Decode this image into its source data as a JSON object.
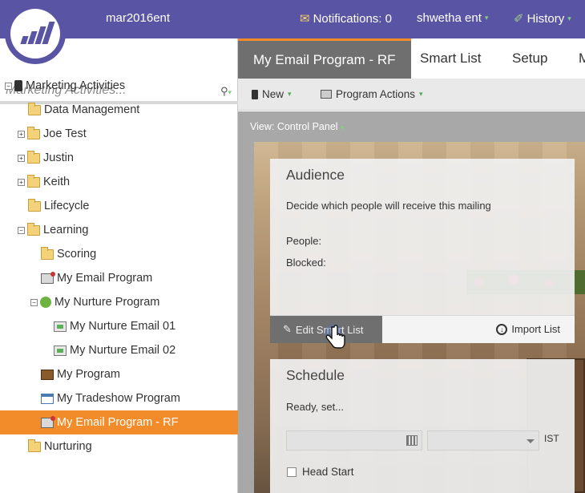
{
  "topbar": {
    "workspace": "mar2016ent",
    "notifications": "Notifications: 0",
    "user": "shwetha ent",
    "history": "History"
  },
  "leftpanel": {
    "search_placeholder": "Marketing Activities...",
    "tree": [
      {
        "label": "Marketing Activities",
        "icon": "marketing-activities-icon",
        "indent": 0,
        "expander": "−"
      },
      {
        "label": "Data Management",
        "icon": "folder-icon",
        "indent": 1,
        "expander": ""
      },
      {
        "label": "Joe Test",
        "icon": "folder-icon",
        "indent": 1,
        "expander": "+"
      },
      {
        "label": "Justin",
        "icon": "folder-icon",
        "indent": 1,
        "expander": "+"
      },
      {
        "label": "Keith",
        "icon": "folder-icon",
        "indent": 1,
        "expander": "+"
      },
      {
        "label": "Lifecycle",
        "icon": "folder-icon",
        "indent": 1,
        "expander": ""
      },
      {
        "label": "Learning",
        "icon": "folder-icon",
        "indent": 1,
        "expander": "−"
      },
      {
        "label": "Scoring",
        "icon": "folder-icon",
        "indent": 2,
        "expander": ""
      },
      {
        "label": "My Email Program",
        "icon": "email-program-icon",
        "indent": 2,
        "expander": ""
      },
      {
        "label": "My Nurture Program",
        "icon": "nurture-program-icon",
        "indent": 2,
        "expander": "−"
      },
      {
        "label": "My Nurture Email 01",
        "icon": "email-asset-icon",
        "indent": 3,
        "expander": ""
      },
      {
        "label": "My Nurture Email 02",
        "icon": "email-asset-icon",
        "indent": 3,
        "expander": ""
      },
      {
        "label": "My Program",
        "icon": "program-icon",
        "indent": 2,
        "expander": ""
      },
      {
        "label": "My Tradeshow Program",
        "icon": "tradeshow-program-icon",
        "indent": 2,
        "expander": ""
      },
      {
        "label": "My Email Program - RF",
        "icon": "email-program-icon",
        "indent": 2,
        "expander": "",
        "selected": true
      },
      {
        "label": "Nurturing",
        "icon": "folder-icon",
        "indent": 1,
        "expander": ""
      }
    ]
  },
  "tabs": [
    {
      "label": "My Email Program - RF",
      "active": true
    },
    {
      "label": "Smart List"
    },
    {
      "label": "Setup"
    },
    {
      "label": "M"
    }
  ],
  "toolbar": {
    "new_label": "New",
    "program_actions_label": "Program Actions"
  },
  "viewbar": {
    "label": "View: Control Panel"
  },
  "audience": {
    "title": "Audience",
    "description": "Decide which people will receive this mailing",
    "people_label": "People:",
    "blocked_label": "Blocked:",
    "edit_smart_list": "Edit Smart List",
    "import_list": "Import List"
  },
  "schedule": {
    "title": "Schedule",
    "status": "Ready, set...",
    "timezone": "IST",
    "head_start": "Head Start"
  },
  "colors": {
    "brand": "#5a54a4",
    "accent": "#f28c2a",
    "tab_active": "#6f6f6f"
  }
}
